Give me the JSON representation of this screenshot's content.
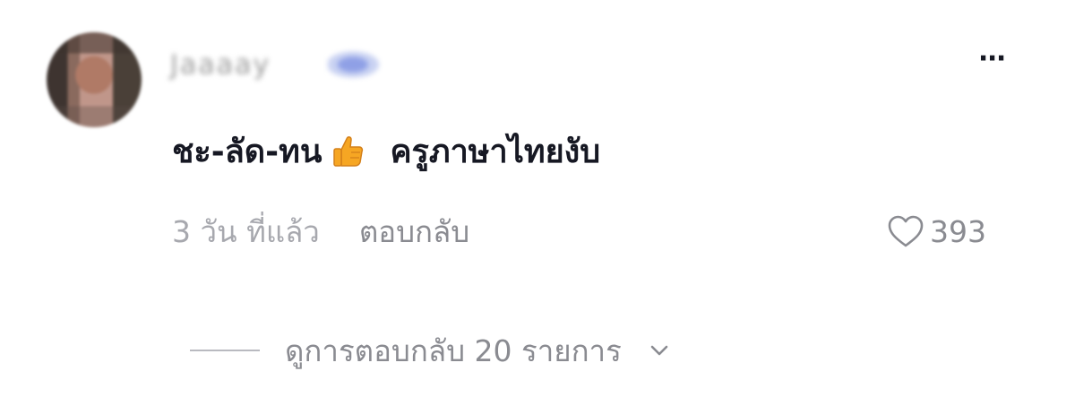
{
  "comment": {
    "username": "Jaaaay",
    "text_before_emoji": "ชะ-ลัด-ทน",
    "emoji": "thumbs-up",
    "text_after_emoji": "ครูภาษาไทยงับ",
    "timestamp": "3 วัน ที่แล้ว",
    "reply_label": "ตอบกลับ",
    "like_count": "393",
    "more_icon": "⋯",
    "view_replies_label": "ดูการตอบกลับ 20 รายการ"
  },
  "colors": {
    "primary_text": "#161823",
    "secondary_text": "#8a8b91",
    "muted_text": "#a7a8ae"
  },
  "icons": [
    "more-icon",
    "thumbs-up-icon",
    "heart-outline-icon",
    "chevron-down-icon"
  ]
}
